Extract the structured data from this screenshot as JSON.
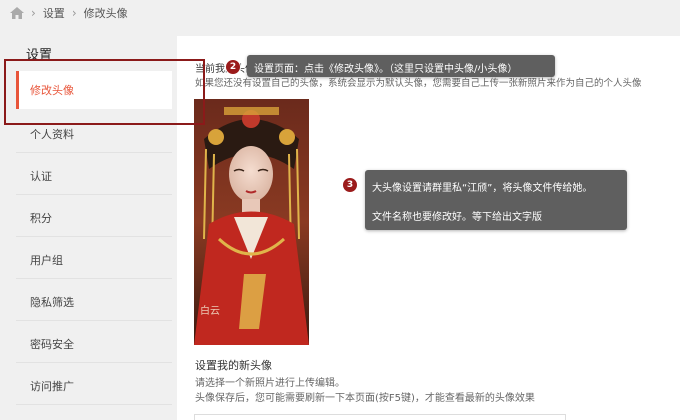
{
  "breadcrumb": {
    "items": [
      "设置",
      "修改头像"
    ]
  },
  "sidebar": {
    "title": "设置",
    "items": [
      {
        "label": "修改头像",
        "active": true
      },
      {
        "label": "个人资料"
      },
      {
        "label": "认证"
      },
      {
        "label": "积分"
      },
      {
        "label": "用户组"
      },
      {
        "label": "隐私筛选"
      },
      {
        "label": "密码安全"
      },
      {
        "label": "访问推广"
      }
    ]
  },
  "main": {
    "current_avatar": "当前我的头像",
    "hint": "如果您还没有设置自己的头像，系统会显示为默认头像，您需要自己上传一张新照片来作为自己的个人头像",
    "new_avatar_title": "设置我的新头像",
    "upload_hint": "请选择一个新照片进行上传编辑。",
    "refresh_hint": "头像保存后，您可能需要刷新一下本页面(按F5键)，才能查看最新的头像效果"
  },
  "annotations": [
    {
      "number": "2",
      "text": "设置页面：点击《修改头像》。（这里只设置中头像/小头像）"
    },
    {
      "number": "3",
      "lines": [
        "大头像设置请群里私“江颀”，将头像文件传给她。",
        "文件名称也要修改好。等下给出文字版"
      ]
    }
  ],
  "avatar_watermark": "白云",
  "colors": {
    "accent": "#e8553a",
    "badge": "#9b1b1b",
    "callout_bg": "#5f5f5f",
    "highlight_border": "#8b1a1a"
  },
  "icons": {
    "home": "home-icon"
  }
}
